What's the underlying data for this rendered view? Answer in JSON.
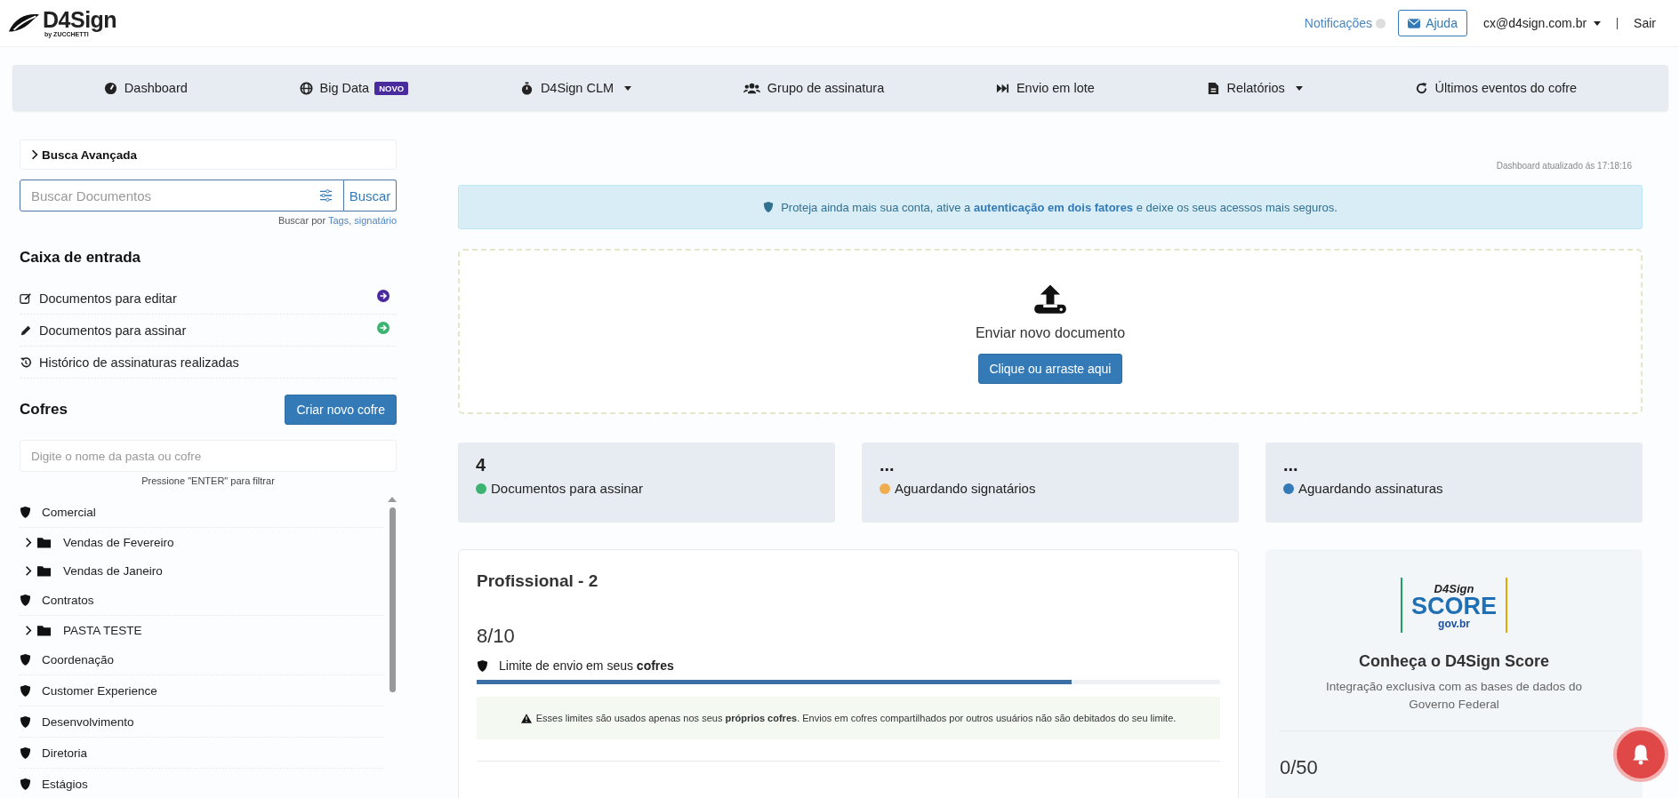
{
  "header": {
    "logo": {
      "name": "D4Sign",
      "byline": "by ZUCCHETTI"
    },
    "notifications": "Notificações",
    "help": "Ajuda",
    "user": "cx@d4sign.com.br",
    "logout": "Sair"
  },
  "nav": [
    {
      "label": "Dashboard",
      "dropdown": false
    },
    {
      "label": "Big Data",
      "badge": "NOVO",
      "dropdown": false
    },
    {
      "label": "D4Sign CLM",
      "dropdown": true
    },
    {
      "label": "Grupo de assinatura",
      "dropdown": false
    },
    {
      "label": "Envio em lote",
      "dropdown": false
    },
    {
      "label": "Relatórios",
      "dropdown": true
    },
    {
      "label": "Últimos eventos do cofre",
      "dropdown": false
    }
  ],
  "sidebar": {
    "advanced_search": {
      "label": "Busca Avançada",
      "expanded": false
    },
    "search": {
      "placeholder": "Buscar Documentos",
      "button": "Buscar",
      "hint": "Buscar por",
      "hint_link": "Tags, signatário"
    },
    "inbox": {
      "title": "Caixa de entrada",
      "items": [
        {
          "label": "Documentos para editar",
          "color": "#4a2b9e"
        },
        {
          "label": "Documentos para assinar",
          "color": "#3cb371"
        },
        {
          "label": "Histórico de assinaturas realizadas"
        }
      ]
    },
    "vaults": {
      "title": "Cofres",
      "create_button": "Criar novo cofre",
      "filter_placeholder": "Digite o nome da pasta ou cofre",
      "filter_hint": "Pressione \"ENTER\" para filtrar",
      "tree": [
        {
          "label": "Comercial",
          "children": [
            {
              "label": "Vendas de Fevereiro",
              "expanded": false
            },
            {
              "label": "Vendas de Janeiro",
              "expanded": false
            }
          ]
        },
        {
          "label": "Contratos",
          "children": [
            {
              "label": "PASTA TESTE",
              "expanded": false
            }
          ]
        },
        {
          "label": "Coordenação"
        },
        {
          "label": "Customer Experience"
        },
        {
          "label": "Desenvolvimento"
        },
        {
          "label": "Diretoria"
        },
        {
          "label": "Estágios"
        }
      ]
    }
  },
  "main": {
    "updated": "Dashboard atualizado ás 17:18:16",
    "alert": {
      "before": "Proteja ainda mais sua conta, ative a ",
      "link": "autenticação em dois fatores",
      "after": " e deixe os seus acessos mais seguros."
    },
    "upload": {
      "title": "Enviar novo documento",
      "button": "Clique ou arraste aqui"
    },
    "stats": [
      {
        "value": "4",
        "label": "Documentos para assinar",
        "color": "#3cb371"
      },
      {
        "value": "...",
        "label": "Aguardando signatários",
        "color": "#f0ad4e"
      },
      {
        "value": "...",
        "label": "Aguardando assinaturas",
        "color": "#337ab7"
      }
    ],
    "plan": {
      "title": "Profissional - 2",
      "usage": "8/10",
      "limit_text": "Limite de envio em seus **cofres**",
      "level": 0.8,
      "note": "Esses limites são usados apenas nos seus **próprios cofres**. Envios em cofres compartilhados por outros usuários não são debitados do seu limite."
    },
    "score": {
      "logo": {
        "brand": "D4Sign",
        "word": "SCORE",
        "partner": "gov.br"
      },
      "title": "Conheça o D4Sign Score",
      "description": "Integração exclusiva com as bases de dados do Governo Federal",
      "usage": "0/50"
    }
  }
}
